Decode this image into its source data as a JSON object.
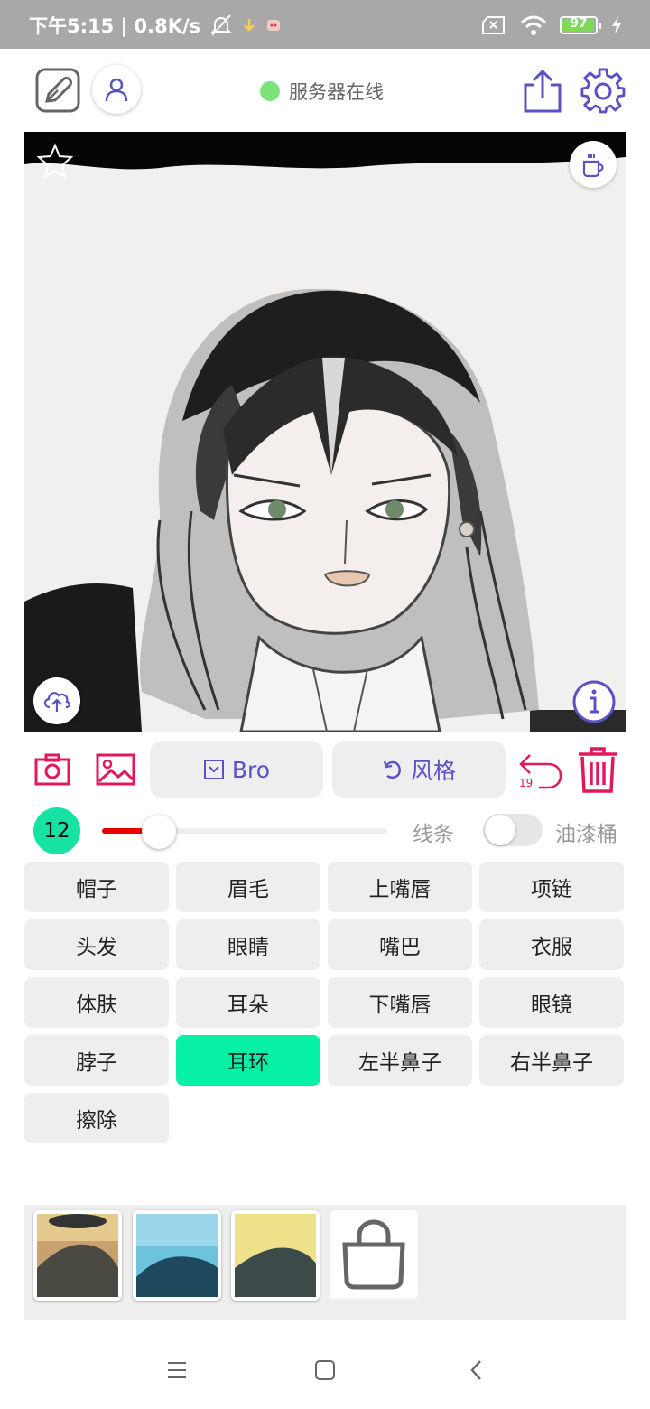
{
  "status_bar": {
    "time_and_speed": "下午5:15 | 0.8K/s",
    "battery_level": "97",
    "battery_fraction": 0.97,
    "icons": [
      "mute-bell-icon",
      "download-arrow-icon",
      "notification-app-icon",
      "sim-x-icon",
      "wifi-icon",
      "battery-icon",
      "charging-bolt-icon"
    ]
  },
  "header": {
    "server_status": "服务器在线",
    "server_status_color": "#7ee27a",
    "icons": [
      "edit-square-icon",
      "user-icon",
      "share-upload-icon",
      "settings-gear-icon"
    ]
  },
  "canvas": {
    "icons": [
      "star-icon",
      "coffee-cup-icon",
      "cloud-upload-icon",
      "info-icon"
    ]
  },
  "toolbar": {
    "style_select_label": "Bro",
    "style_button_label": "风格",
    "undo_count": "19",
    "accent_color": "#e2185b",
    "primary_color": "#5b52c2",
    "icons": [
      "camera-icon",
      "gallery-image-icon",
      "dropdown-box-icon",
      "refresh-icon",
      "undo-icon",
      "trash-icon"
    ]
  },
  "brush": {
    "size": "12",
    "slider_fraction": 0.2,
    "line_label": "线条",
    "bucket_label": "油漆桶",
    "bucket_enabled": false,
    "track_color": "#e80000",
    "badge_color": "#16e2a4"
  },
  "parts": {
    "items": [
      "帽子",
      "眉毛",
      "上嘴唇",
      "项链",
      "头发",
      "眼睛",
      "嘴巴",
      "衣服",
      "体肤",
      "耳朵",
      "下嘴唇",
      "眼镜",
      "脖子",
      "耳环",
      "左半鼻子",
      "右半鼻子",
      "擦除"
    ],
    "selected": "耳环",
    "selected_color": "#06f0a6"
  },
  "style_strip": {
    "thumbnails": [
      "style-thumb-1",
      "style-thumb-2",
      "style-thumb-3"
    ],
    "store_icon": "shopping-bag-icon"
  },
  "nav": {
    "icons": [
      "menu-lines-icon",
      "home-square-icon",
      "back-chevron-icon"
    ]
  }
}
